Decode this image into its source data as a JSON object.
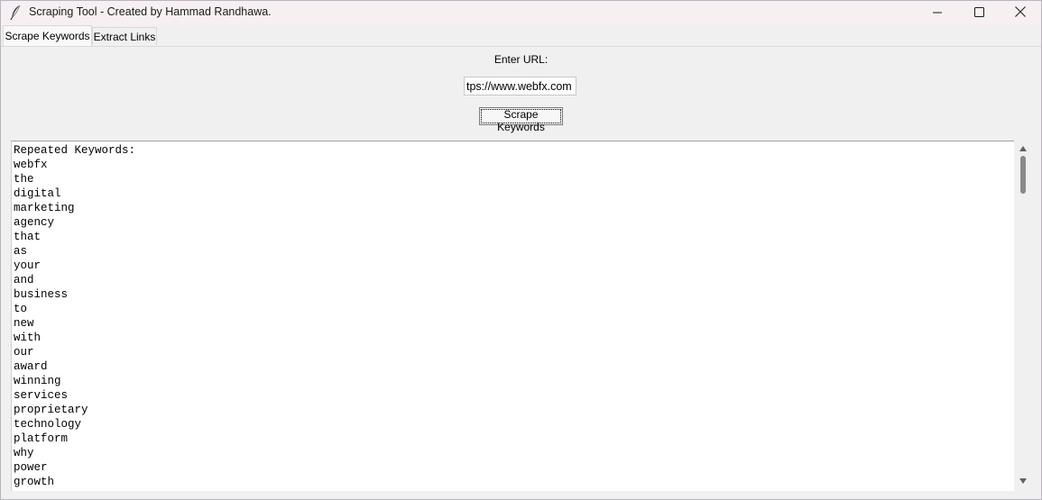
{
  "window": {
    "title": "Scraping Tool - Created by Hammad Randhawa."
  },
  "icons": {
    "app": "feather-icon",
    "minimize": "minimize-icon",
    "maximize": "maximize-icon",
    "close": "close-icon",
    "scroll_up": "triangle-up-icon",
    "scroll_down": "triangle-down-icon"
  },
  "tabs": [
    {
      "label": "Scrape Keywords",
      "active": true
    },
    {
      "label": "Extract Links",
      "active": false
    }
  ],
  "form": {
    "url_label": "Enter URL:",
    "url_value": "tps://www.webfx.com",
    "button_label": "Scrape Keywords"
  },
  "results": {
    "heading": "Repeated Keywords:",
    "keywords": [
      "webfx",
      "the",
      "digital",
      "marketing",
      "agency",
      "that",
      "as",
      "your",
      "and",
      "business",
      "to",
      "new",
      "with",
      "our",
      "award",
      "winning",
      "services",
      "proprietary",
      "technology",
      "platform",
      "why",
      "power",
      "growth"
    ]
  }
}
